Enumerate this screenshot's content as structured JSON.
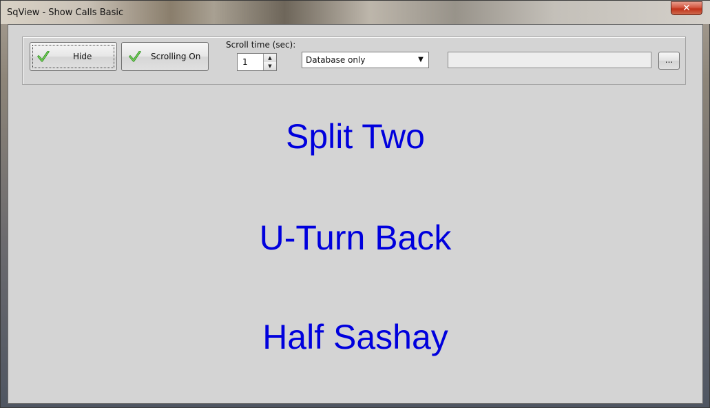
{
  "window": {
    "title": "SqView - Show Calls Basic",
    "close_glyph": "✕"
  },
  "toolbar": {
    "hide_label": "Hide",
    "scrolling_label": "Scrolling On",
    "scroll_time_label": "Scroll time (sec):",
    "scroll_time_value": "1",
    "source_select_value": "Database only",
    "path_value": "",
    "browse_label": "...",
    "check_icon": "check-icon"
  },
  "calls": [
    "Split Two",
    "U-Turn Back",
    "Half Sashay"
  ],
  "colors": {
    "call_text": "#0000dd",
    "client_bg": "#d4d4d4",
    "check_green": "#3fae2a"
  }
}
